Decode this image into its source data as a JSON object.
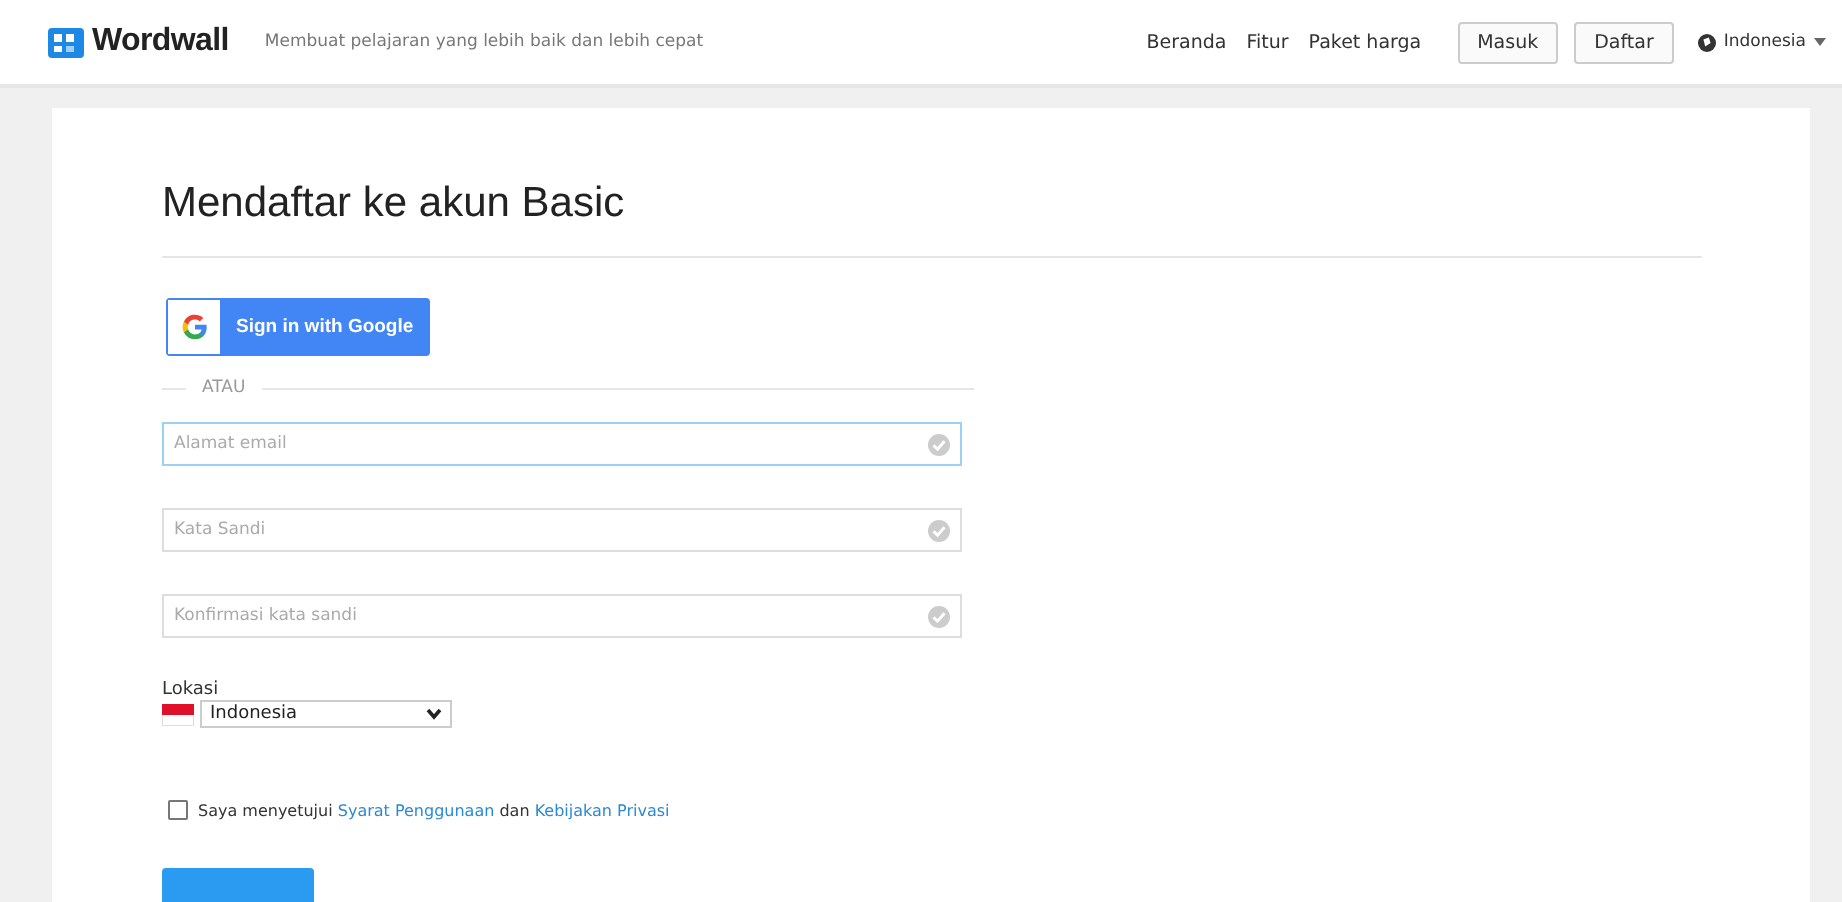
{
  "header": {
    "logo": "Wordwall",
    "tagline": "Membuat pelajaran yang lebih baik dan lebih cepat",
    "nav": [
      "Beranda",
      "Fitur",
      "Paket harga"
    ],
    "buttons": [
      "Masuk",
      "Daftar"
    ],
    "language": "Indonesia"
  },
  "form": {
    "title": "Mendaftar ke akun Basic",
    "google_button": "Sign in with Google",
    "divider": "ATAU",
    "fields": [
      {
        "placeholder": "Alamat email",
        "focused": true
      },
      {
        "placeholder": "Kata Sandi",
        "focused": false
      },
      {
        "placeholder": "Konfirmasi kata sandi",
        "focused": false
      }
    ],
    "location_label": "Lokasi",
    "location_value": "Indonesia",
    "agree": {
      "checked": false,
      "text_before": "Saya menyetujui",
      "link_1": "Syarat Penggunaan",
      "middle": "dan",
      "link_2": "Kebijakan Privasi"
    }
  }
}
